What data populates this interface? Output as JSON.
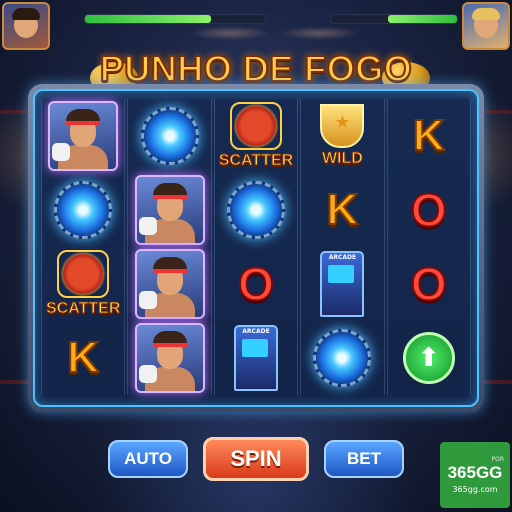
{
  "game": {
    "title": "PUNHO DE FOGO"
  },
  "hud": {
    "player_health_fraction": 0.7,
    "opponent_health_fraction": 0.55
  },
  "grid": [
    [
      {
        "type": "hero",
        "label": ""
      },
      {
        "type": "vortex",
        "label": ""
      },
      {
        "type": "scatter",
        "label": "SCATTER"
      },
      {
        "type": "k",
        "label": "K"
      }
    ],
    [
      {
        "type": "vortex",
        "label": ""
      },
      {
        "type": "hero",
        "label": ""
      },
      {
        "type": "hero",
        "label": ""
      },
      {
        "type": "hero",
        "label": ""
      }
    ],
    [
      {
        "type": "scatter",
        "label": "SCATTER"
      },
      {
        "type": "vortex",
        "label": ""
      },
      {
        "type": "o",
        "label": "O"
      },
      {
        "type": "arcade",
        "label": "ARCADE"
      }
    ],
    [
      {
        "type": "wild",
        "label": "WILD"
      },
      {
        "type": "k",
        "label": "K"
      },
      {
        "type": "arcade",
        "label": "ARCADE"
      },
      {
        "type": "vortex",
        "label": ""
      }
    ],
    [
      {
        "type": "k",
        "label": "K"
      },
      {
        "type": "o",
        "label": "O"
      },
      {
        "type": "o",
        "label": "O"
      },
      {
        "type": "arrow",
        "label": ""
      }
    ]
  ],
  "controls": {
    "auto_label": "AUTO",
    "spin_label": "SPIN",
    "bet_label": "BET"
  },
  "badge": {
    "top": "POR",
    "main": "365GG",
    "site": "365gg.com"
  },
  "colors": {
    "frame_glow": "#49c4ff",
    "title_gold": "#ffcd4a",
    "spin_button": "#d83a1a",
    "side_buttons": "#1f57c6",
    "badge_green": "#2f9a3c"
  }
}
